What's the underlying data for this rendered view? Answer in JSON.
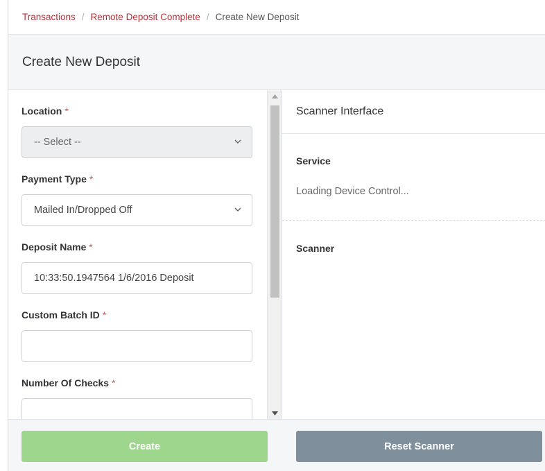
{
  "breadcrumb": {
    "items": [
      "Transactions",
      "Remote Deposit Complete",
      "Create New Deposit"
    ],
    "separator": "/"
  },
  "header": {
    "title": "Create New Deposit"
  },
  "form": {
    "location": {
      "label": "Location",
      "required_mark": "*",
      "value": "-- Select --"
    },
    "payment_type": {
      "label": "Payment Type",
      "required_mark": "*",
      "value": "Mailed In/Dropped Off"
    },
    "deposit_name": {
      "label": "Deposit Name",
      "required_mark": "*",
      "value": "10:33:50.1947564 1/6/2016 Deposit"
    },
    "custom_batch_id": {
      "label": "Custom Batch ID",
      "required_mark": "*",
      "value": ""
    },
    "number_of_checks": {
      "label": "Number Of Checks",
      "required_mark": "*",
      "value": ""
    }
  },
  "scanner": {
    "title": "Scanner Interface",
    "service_label": "Service",
    "service_status": "Loading Device Control...",
    "scanner_label": "Scanner"
  },
  "buttons": {
    "create": "Create",
    "reset": "Reset Scanner"
  },
  "colors": {
    "breadcrumb_link": "#b5333a",
    "required": "#d9534f",
    "create_button": "#9fd68e",
    "reset_button": "#7f909c"
  },
  "icons": {
    "select_chevron": "chevron-down-icon",
    "scroll_up": "scroll-up-arrow-icon",
    "scroll_down": "scroll-down-arrow-icon"
  }
}
